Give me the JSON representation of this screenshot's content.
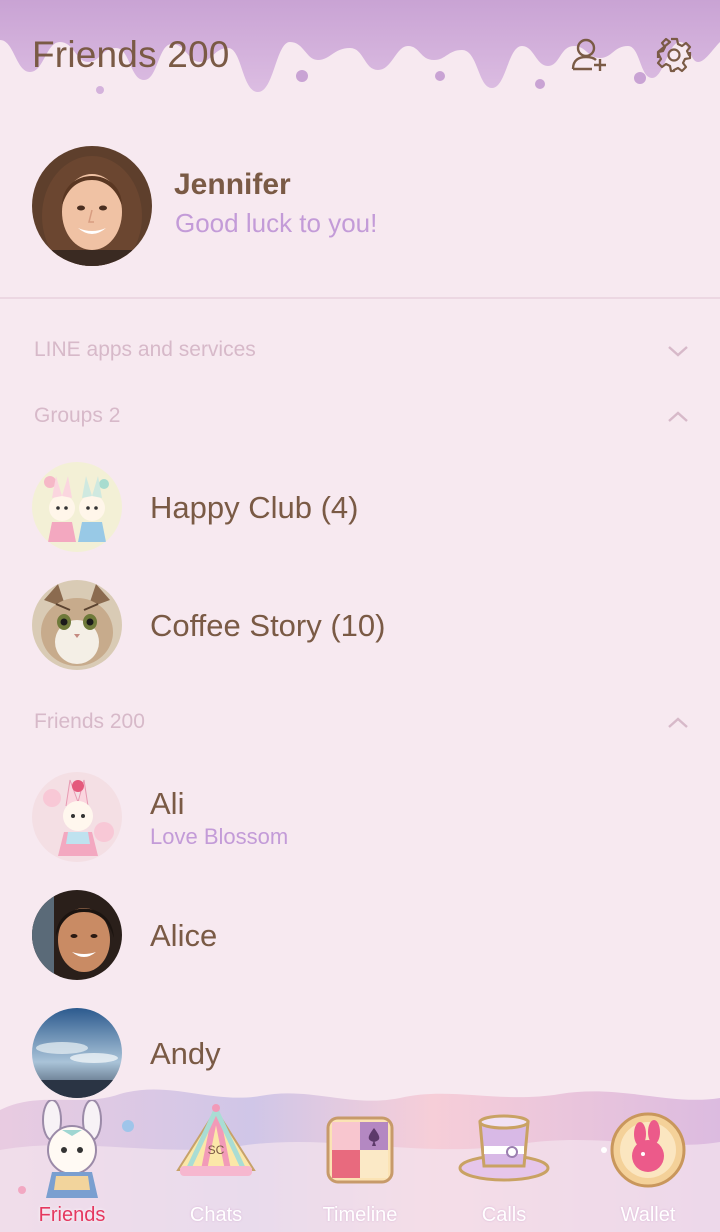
{
  "header": {
    "title": "Friends 200",
    "add_friend_icon": "add-friend-icon",
    "settings_icon": "gear-icon"
  },
  "profile": {
    "name": "Jennifer",
    "status": "Good luck to you!"
  },
  "sections": {
    "apps": {
      "label": "LINE apps and services",
      "state": "collapsed"
    },
    "groups": {
      "label": "Groups 2",
      "state": "expanded"
    },
    "friends": {
      "label": "Friends 200",
      "state": "expanded"
    }
  },
  "groups": [
    {
      "name": "Happy Club (4)"
    },
    {
      "name": "Coffee Story (10)"
    }
  ],
  "friends": [
    {
      "name": "Ali",
      "status": "Love Blossom"
    },
    {
      "name": "Alice",
      "status": ""
    },
    {
      "name": "Andy",
      "status": ""
    }
  ],
  "tabs": [
    {
      "label": "Friends",
      "active": true
    },
    {
      "label": "Chats",
      "active": false
    },
    {
      "label": "Timeline",
      "active": false
    },
    {
      "label": "Calls",
      "active": false
    },
    {
      "label": "Wallet",
      "active": false
    }
  ],
  "colors": {
    "background": "#f7e9f0",
    "text": "#7a5a45",
    "status": "#c39bd8",
    "section_label": "#d7b9c9",
    "active_tab": "#e5385f"
  }
}
